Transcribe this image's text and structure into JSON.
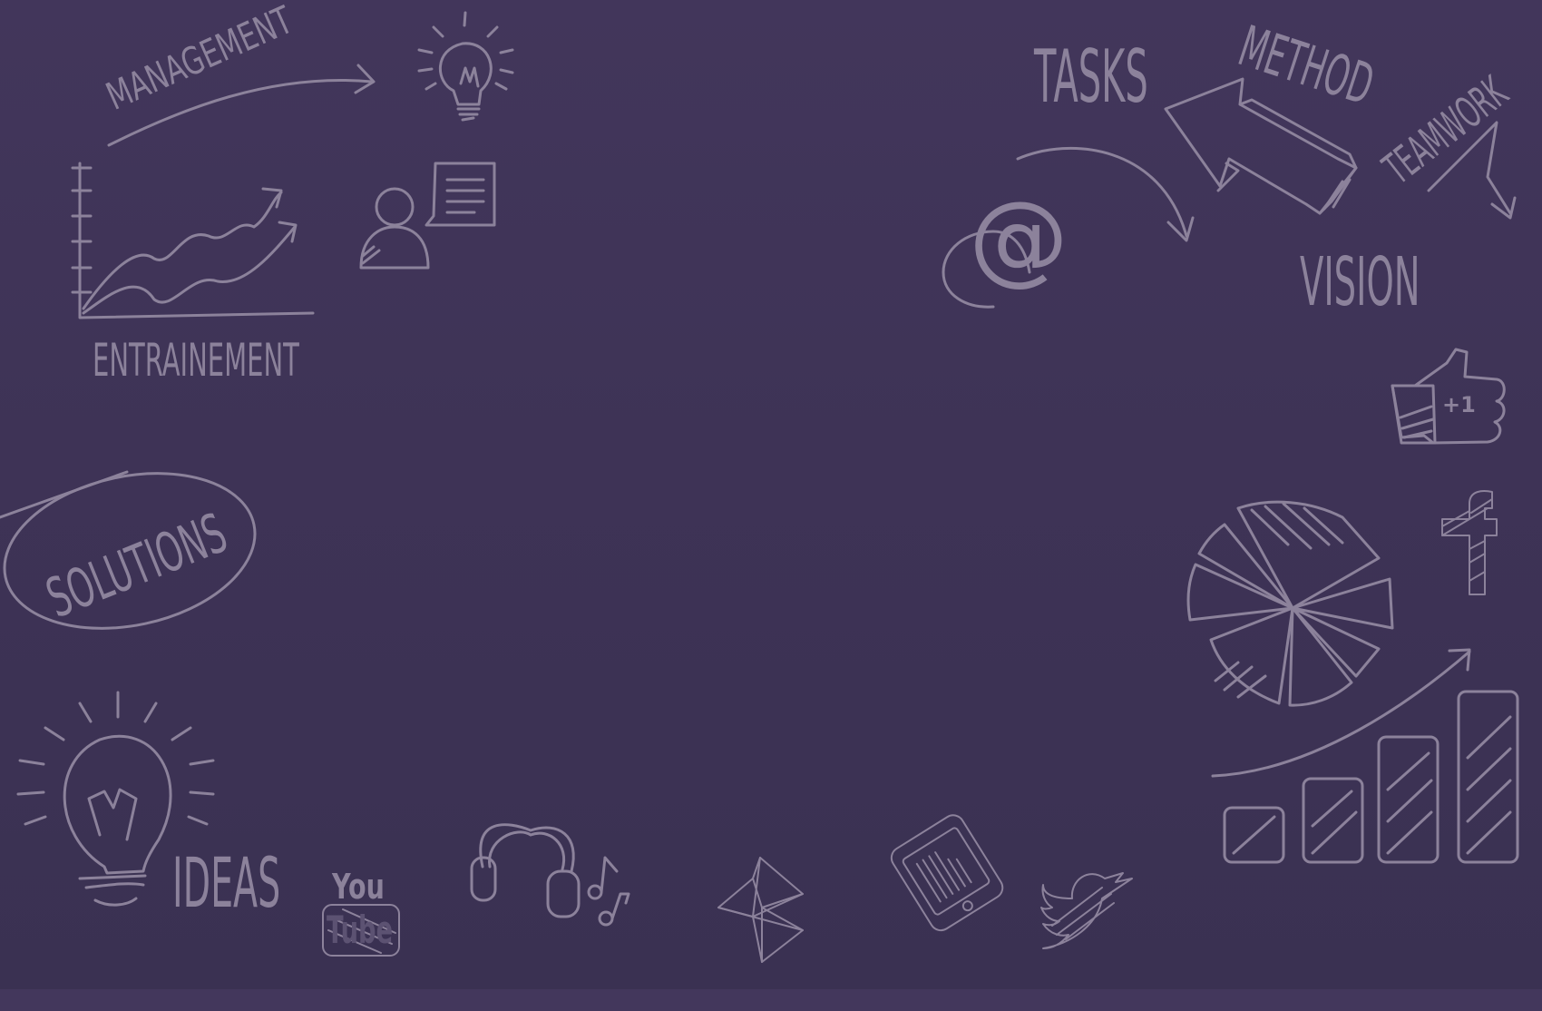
{
  "colors": {
    "background": "#3f3558",
    "background_band": "#43375c",
    "ink": "#8c829b"
  },
  "words": {
    "management": "MANAGEMENT",
    "entrainement": "ENTRAINEMENT",
    "solutions": "SOLUTIONS",
    "ideas": "IDEAS",
    "tasks": "TASKS",
    "method": "METHOD",
    "teamwork": "TEAMWORK",
    "vision": "VISION",
    "plus_one": "+1",
    "youtube_you": "You",
    "youtube_tube": "Tube",
    "at_sign": "@"
  },
  "icons": [
    "lightbulb-icon",
    "line-chart-icon",
    "user-speech-icon",
    "arrow-icon",
    "thumbs-up-icon",
    "facebook-icon",
    "pie-chart-icon",
    "bar-chart-icon",
    "headphones-icon",
    "music-notes-icon",
    "origami-icon",
    "phone-icon",
    "twitter-bird-icon",
    "youtube-icon"
  ]
}
